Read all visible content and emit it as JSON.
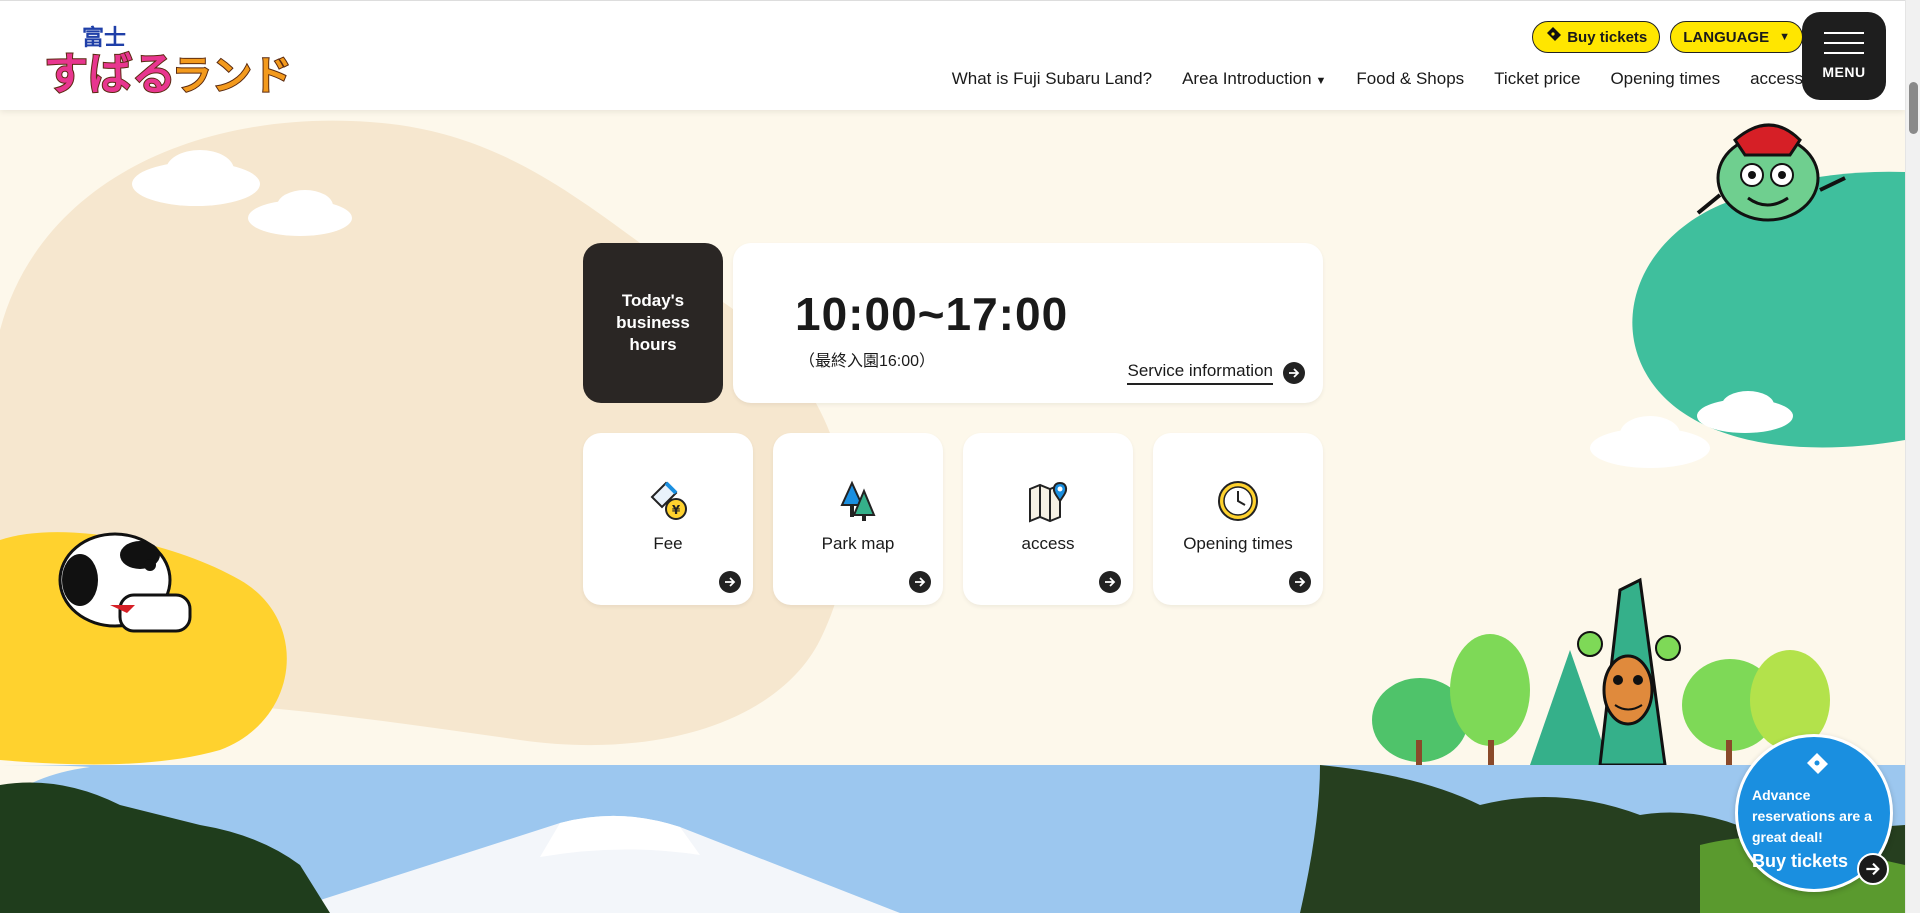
{
  "header": {
    "logo_top_text": "富士",
    "logo_main_text": "すばるランド",
    "buy_tickets_label": "Buy tickets",
    "language_label": "LANGUAGE",
    "nav": [
      {
        "label": "What is Fuji Subaru Land?"
      },
      {
        "label": "Area Introduction"
      },
      {
        "label": "Food & Shops"
      },
      {
        "label": "Ticket price"
      },
      {
        "label": "Opening times"
      },
      {
        "label": "access"
      }
    ],
    "menu_label": "MENU"
  },
  "hours": {
    "label": "Today's business hours",
    "time": "10:00~17:00",
    "last_entry": "（最終入園16:00）",
    "service_link": "Service information"
  },
  "quick_links": [
    {
      "label": "Fee",
      "icon": "ticket-yen-icon"
    },
    {
      "label": "Park map",
      "icon": "trees-icon"
    },
    {
      "label": "access",
      "icon": "map-pin-icon"
    },
    {
      "label": "Opening times",
      "icon": "clock-icon"
    }
  ],
  "float_badge": {
    "message": "Advance reservations are a great deal!",
    "cta": "Buy tickets"
  },
  "colors": {
    "accent_yellow": "#ffe600",
    "badge_blue": "#1a8fe0",
    "dark": "#2a2624",
    "page_bg": "#fdf8eb"
  }
}
